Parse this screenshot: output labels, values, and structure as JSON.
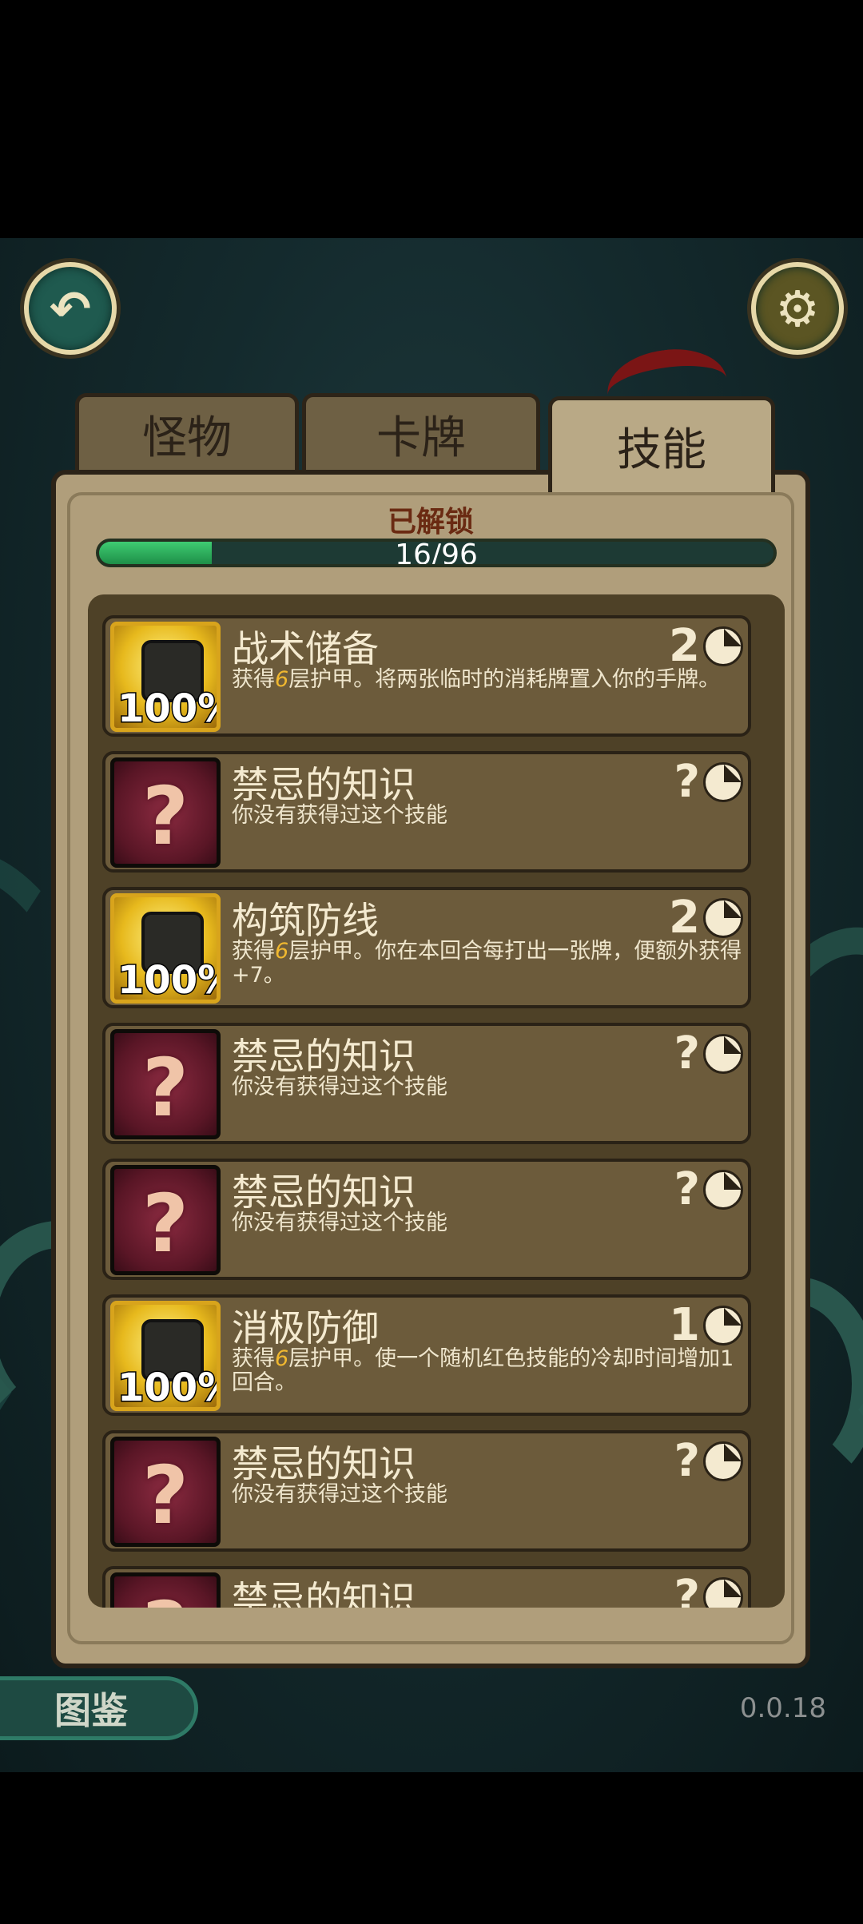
{
  "tabs": [
    {
      "label": "怪物"
    },
    {
      "label": "卡牌"
    },
    {
      "label": "技能"
    }
  ],
  "panel": {
    "unlocked_label": "已解锁",
    "progress_text": "16/96",
    "progress_fraction": 0.1667
  },
  "skills": [
    {
      "name": "战术储备",
      "cost": "2",
      "unlocked": true,
      "percent": "100%",
      "desc_pre": "获得",
      "desc_num": "6",
      "desc_post": "层护甲。将两张临时的消耗牌置入你的手牌。"
    },
    {
      "name": "禁忌的知识",
      "cost": "?",
      "unlocked": false,
      "desc": "你没有获得过这个技能"
    },
    {
      "name": "构筑防线",
      "cost": "2",
      "unlocked": true,
      "percent": "100%",
      "desc_pre": "获得",
      "desc_num": "6",
      "desc_post": "层护甲。你在本回合每打出一张牌，便额外获得+7。"
    },
    {
      "name": "禁忌的知识",
      "cost": "?",
      "unlocked": false,
      "desc": "你没有获得过这个技能"
    },
    {
      "name": "禁忌的知识",
      "cost": "?",
      "unlocked": false,
      "desc": "你没有获得过这个技能"
    },
    {
      "name": "消极防御",
      "cost": "1",
      "unlocked": true,
      "percent": "100%",
      "desc_pre": "获得",
      "desc_num": "6",
      "desc_post": "层护甲。使一个随机红色技能的冷却时间增加1回合。"
    },
    {
      "name": "禁忌的知识",
      "cost": "?",
      "unlocked": false,
      "desc": "你没有获得过这个技能"
    },
    {
      "name": "禁忌的知识",
      "cost": "?",
      "unlocked": false,
      "desc": ""
    }
  ],
  "footer": {
    "atlas_label": "图鉴",
    "version": "0.0.18"
  },
  "icons": {
    "back": "back-arrow-icon",
    "settings": "gear-icon",
    "cooldown": "clock-icon"
  }
}
